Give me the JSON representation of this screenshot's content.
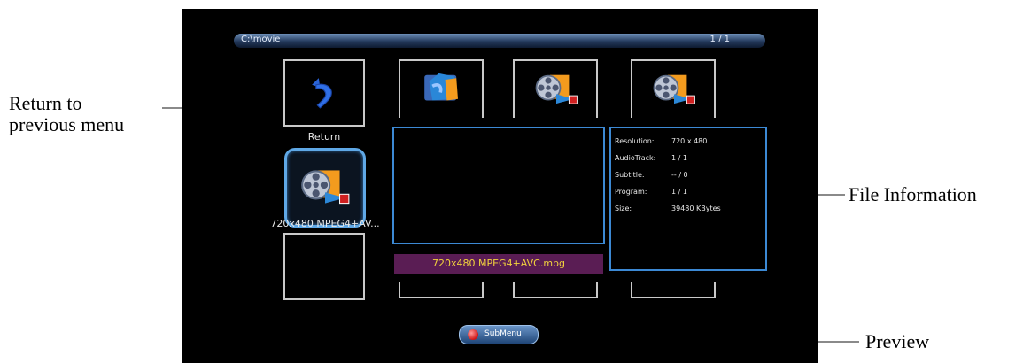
{
  "header": {
    "path": "C:\\movie",
    "page_indicator": "1 / 1"
  },
  "thumbnails": [
    {
      "label": "Return",
      "icon": "return-arrow-icon"
    },
    {
      "label": "",
      "icon": "folder-icon"
    },
    {
      "label": "",
      "icon": "video-file-icon"
    },
    {
      "label": "",
      "icon": "video-file-icon"
    },
    {
      "label": "720x480 MPEG4+AV...",
      "icon": "video-file-icon"
    }
  ],
  "preview": {
    "filename": "720x480 MPEG4+AVC.mpg"
  },
  "file_info": [
    {
      "key": "Resolution:",
      "value": "720 x 480"
    },
    {
      "key": "AudioTrack:",
      "value": "1 / 1"
    },
    {
      "key": "Subtitle:",
      "value": "-- / 0"
    },
    {
      "key": "Program:",
      "value": "1 / 1"
    },
    {
      "key": "Size:",
      "value": "39480 KBytes"
    }
  ],
  "footer": {
    "submenu_label": "SubMenu"
  },
  "annotations": {
    "return_line1": "Return to",
    "return_line2": "previous menu",
    "file_information": "File Information",
    "preview": "Preview"
  },
  "colors": {
    "selection_border": "#5fa8e6",
    "panel_border": "#3c89d4",
    "filename_bar": "#5a1d54",
    "filename_text": "#f1d23d"
  }
}
